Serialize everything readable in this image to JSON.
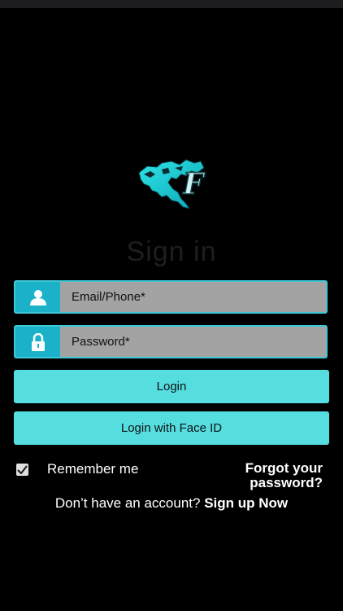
{
  "title": "Sign in",
  "logo": {
    "icon": "map-f-logo-icon",
    "letter": "F"
  },
  "email": {
    "placeholder": "Email/Phone*",
    "value": ""
  },
  "password": {
    "placeholder": "Password*",
    "value": ""
  },
  "buttons": {
    "login": "Login",
    "face_id": "Login with Face ID"
  },
  "remember": {
    "label": "Remember me",
    "checked": true
  },
  "forgot": {
    "line1": "Forgot your",
    "line2": "password?"
  },
  "signup": {
    "prompt": "Don’t have an account?",
    "link": "Sign up Now"
  },
  "colors": {
    "accent": "#55dde0",
    "icon_box": "#1bb2c9",
    "field_bg": "#a3a3a3",
    "background": "#000000"
  }
}
